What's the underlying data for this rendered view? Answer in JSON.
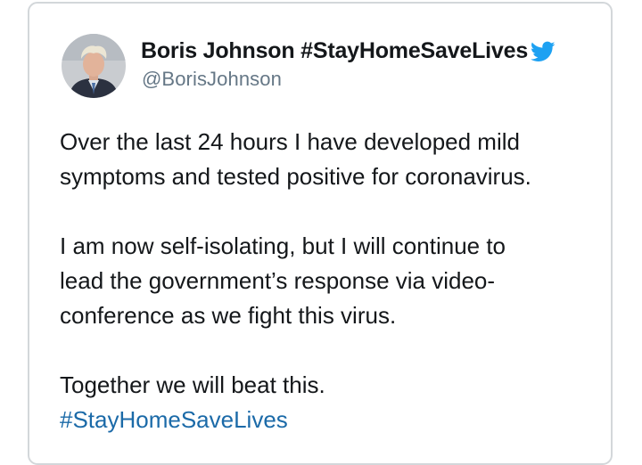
{
  "tweet": {
    "author": {
      "display_name": "Boris Johnson #StayHomeSaveLives",
      "handle": "@BorisJohnson",
      "avatar_icon": "profile-photo",
      "verified_badge_icon": "twitter-bird-icon",
      "badge_color": "#1da1f2"
    },
    "paragraphs": [
      {
        "lines": [
          "Over the last 24 hours I have developed mild",
          "symptoms and tested positive for coronavirus."
        ]
      },
      {
        "lines": [
          "I am now self-isolating, but I will continue to",
          "lead the government’s response via video-",
          "conference as we fight this virus."
        ]
      },
      {
        "lines": [
          "Together we will beat this."
        ]
      }
    ],
    "hashtag": "#StayHomeSaveLives",
    "hashtag_color": "#1b6aa8"
  }
}
